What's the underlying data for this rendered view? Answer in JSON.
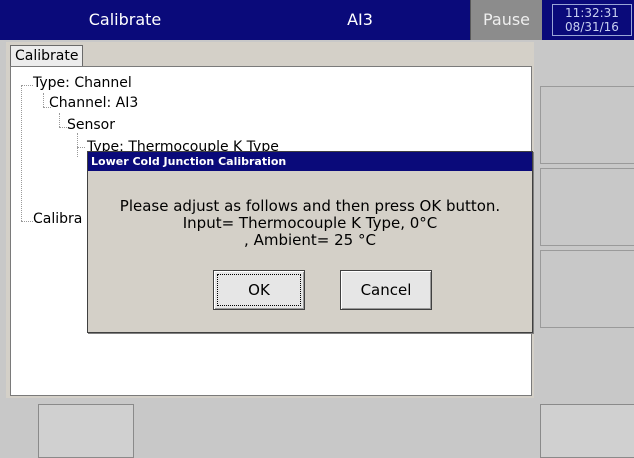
{
  "header": {
    "title": "Calibrate",
    "channel": "AI3",
    "pause_label": "Pause",
    "time": "11:32:31",
    "date": "08/31/16"
  },
  "panel": {
    "tab_label": "Calibrate",
    "tree": {
      "type": "Type: Channel",
      "channel": "Channel: AI3",
      "sensor": "Sensor",
      "sensor_type": "Type: Thermocouple K Type",
      "calibrate": "Calibra"
    }
  },
  "dialog": {
    "title": "Lower Cold Junction Calibration",
    "message_line1": "Please adjust as follows and then press OK button.",
    "message_line2": "Input= Thermocouple K Type, 0°C",
    "message_line3": ", Ambient= 25 °C",
    "ok_label": "OK",
    "cancel_label": "Cancel"
  },
  "colors": {
    "title_bar": "#0a0a7a",
    "dialog_title": "#0a0a7a",
    "background": "#c8c8c8"
  }
}
